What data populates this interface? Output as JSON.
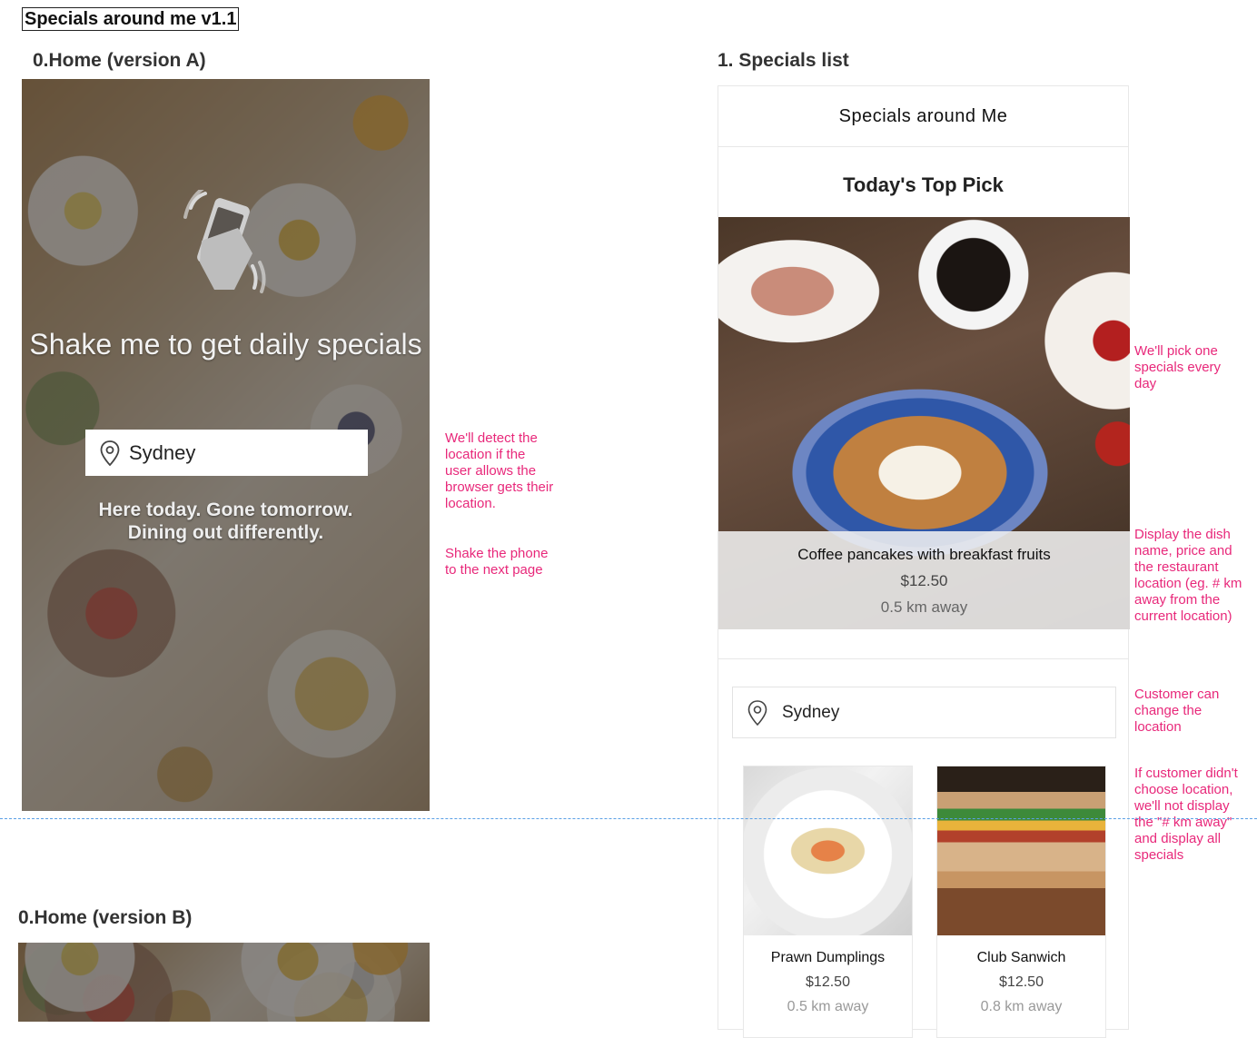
{
  "doc_title": "Specials around me v1.1",
  "home_a": {
    "section_title": "0.Home (version A)",
    "shake_text": "Shake me to get daily specials",
    "location": "Sydney",
    "tagline_1": "Here today. Gone tomorrow.",
    "tagline_2": "Dining out differently."
  },
  "home_b": {
    "section_title": "0.Home (version B)"
  },
  "notes": {
    "detect_location": "We'll detect the location if the user allows the browser gets their location.",
    "shake_phone": "Shake the phone to the next page",
    "pick_one": "We'll pick one specials every day",
    "display_dish": "Display the dish name, price and the restaurant location (eg. # km away from the current location)",
    "change_location": "Customer can change the location",
    "no_location": "If customer didn't choose location, we'll not display the \"# km away\" and display all specials"
  },
  "specials_list": {
    "section_title": "1. Specials list",
    "header": "Specials around Me",
    "top_pick_title": "Today's Top Pick",
    "top_pick": {
      "name": "Coffee pancakes with breakfast fruits",
      "price": "$12.50",
      "distance": "0.5 km away"
    },
    "location": "Sydney",
    "items": [
      {
        "name": "Prawn Dumplings",
        "price": "$12.50",
        "distance": "0.5 km away"
      },
      {
        "name": "Club Sanwich",
        "price": "$12.50",
        "distance": "0.8 km away"
      }
    ]
  },
  "colors": {
    "note": "#e8287a",
    "guide_line": "#5aa0e6"
  }
}
